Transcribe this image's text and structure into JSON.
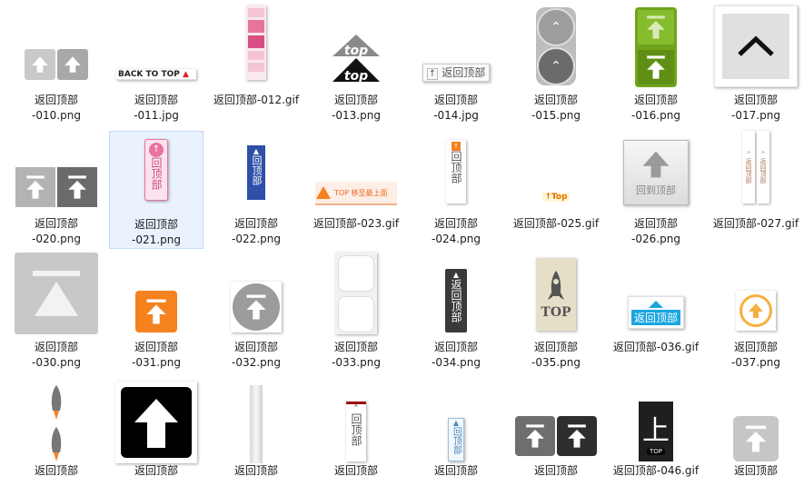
{
  "files": [
    {
      "name": "返回顶部\n-010.png",
      "type": "grey-pair"
    },
    {
      "name": "返回顶部\n-011.jpg",
      "type": "back-to-top",
      "text": "BACK TO TOP"
    },
    {
      "name": "返回顶部-012.gif",
      "type": "pink-strip"
    },
    {
      "name": "返回顶部\n-013.png",
      "type": "top-triangles",
      "text": "top"
    },
    {
      "name": "返回顶部\n-014.jpg",
      "type": "return-button",
      "text": "返回顶部"
    },
    {
      "name": "返回顶部\n-015.png",
      "type": "grey-circles"
    },
    {
      "name": "返回顶部\n-016.png",
      "type": "green-arrows"
    },
    {
      "name": "返回顶部\n-017.png",
      "type": "chevron-box"
    },
    {
      "name": "返回顶部\n-020.png",
      "type": "grey-pair-2"
    },
    {
      "name": "返回顶部\n-021.png",
      "type": "pink-vertical",
      "text": "回顶部"
    },
    {
      "name": "返回顶部\n-022.png",
      "type": "blue-vertical",
      "text": "回顶部"
    },
    {
      "name": "返回顶部-023.gif",
      "type": "orange-banner",
      "text": "TOP 移至最上面"
    },
    {
      "name": "返回顶部\n-024.png",
      "type": "white-vertical",
      "text": "回顶部"
    },
    {
      "name": "返回顶部-025.gif",
      "type": "small-top",
      "text": "Top"
    },
    {
      "name": "返回顶部\n-026.png",
      "type": "grey-square",
      "text": "回到顶部"
    },
    {
      "name": "返回顶部-027.gif",
      "type": "thin-strips",
      "text": "返回顶部"
    },
    {
      "name": "返回顶部\n-030.png",
      "type": "big-grey"
    },
    {
      "name": "返回顶部\n-031.png",
      "type": "orange-square"
    },
    {
      "name": "返回顶部\n-032.png",
      "type": "grey-circle"
    },
    {
      "name": "返回顶部\n-033.png",
      "type": "rounded-pair"
    },
    {
      "name": "返回顶部\n-034.png",
      "type": "dark-vertical",
      "text": "返回顶部"
    },
    {
      "name": "返回顶部\n-035.png",
      "type": "rocket-card",
      "text": "TOP"
    },
    {
      "name": "返回顶部-036.gif",
      "type": "cyan-button",
      "text": "返回顶部"
    },
    {
      "name": "返回顶部\n-037.png",
      "type": "gold-circle"
    },
    {
      "name": "返回顶部",
      "type": "rockets"
    },
    {
      "name": "返回顶部",
      "type": "black-arrow"
    },
    {
      "name": "返回顶部",
      "type": "silver-strip"
    },
    {
      "name": "返回顶部",
      "type": "red-vertical",
      "text": "回顶部"
    },
    {
      "name": "返回顶部",
      "type": "light-vertical",
      "text": "回顶部"
    },
    {
      "name": "返回顶部",
      "type": "dark-pair"
    },
    {
      "name": "返回顶部-046.gif",
      "type": "shang",
      "text": "上",
      "sub": "TOP"
    },
    {
      "name": "返回顶部",
      "type": "grey-rounded"
    }
  ],
  "selected_index": 9,
  "colors": {
    "accent": "#7cb519",
    "orange": "#f5821f",
    "pink": "#e8739e",
    "blue": "#2f4fa8",
    "cyan": "#1aa5e0"
  }
}
